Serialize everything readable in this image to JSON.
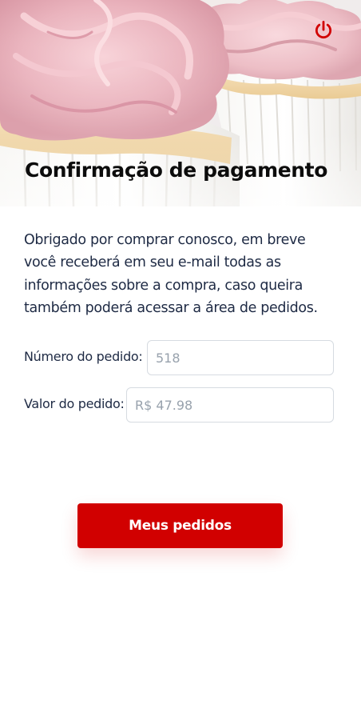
{
  "header": {
    "title": "Confirmação de pagamento",
    "power_icon": "power-icon"
  },
  "main": {
    "message": "Obrigado por comprar conosco, em breve você receberá em seu e-mail todas as informações sobre a compra, caso queira também poderá acessar a área de pedidos.",
    "fields": {
      "order_number": {
        "label": "Número do pedido:",
        "value": "518"
      },
      "order_value": {
        "label": "Valor do pedido:",
        "value": "R$ 47.98"
      }
    },
    "primary_button_label": "Meus pedidos"
  },
  "colors": {
    "accent": "#d10000",
    "text": "#1e2a44",
    "input_text": "#98a2ad",
    "input_border": "#d6dbe1"
  }
}
